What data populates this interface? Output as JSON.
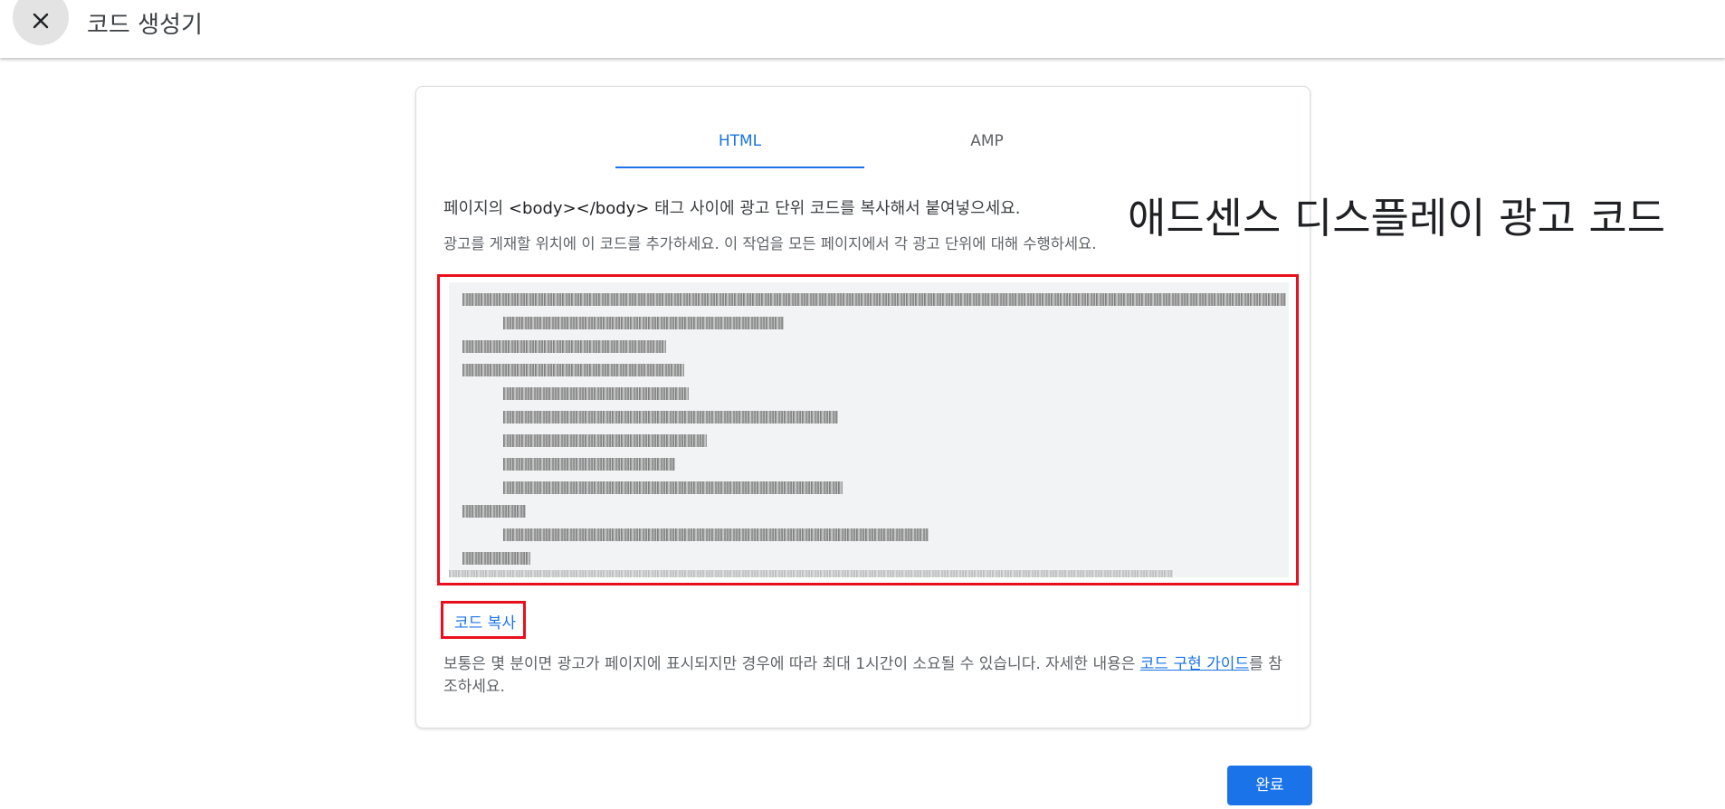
{
  "header": {
    "close_icon": "close-icon",
    "title": "코드 생성기"
  },
  "tabs": [
    {
      "label": "HTML",
      "active": true
    },
    {
      "label": "AMP",
      "active": false
    }
  ],
  "instructions": {
    "line1_prefix": "페이지의 ",
    "line1_tag": "<body></body>",
    "line1_suffix": " 태그 사이에 광고 단위 코드를 복사해서 붙여넣으세요.",
    "line2": "광고를 게재할 위치에 이 코드를 추가하세요. 이 작업을 모든 페이지에서 각 광고 단위에 대해 수행하세요."
  },
  "code_copy_label": "코드 복사",
  "note": {
    "text": "보통은 몇 분이면 광고가 페이지에 표시되지만 경우에 따라 최대 1시간이 소요될 수 있습니다. 자세한 내용은 ",
    "link": "코드 구현 가이드",
    "suffix": "를 참조하세요."
  },
  "done_label": "완료",
  "overlay_caption": "애드센스 디스플레이 광고 코드",
  "colors": {
    "accent": "#1a73e8",
    "highlight": "#e8101c",
    "code_bg": "#f1f3f4"
  }
}
